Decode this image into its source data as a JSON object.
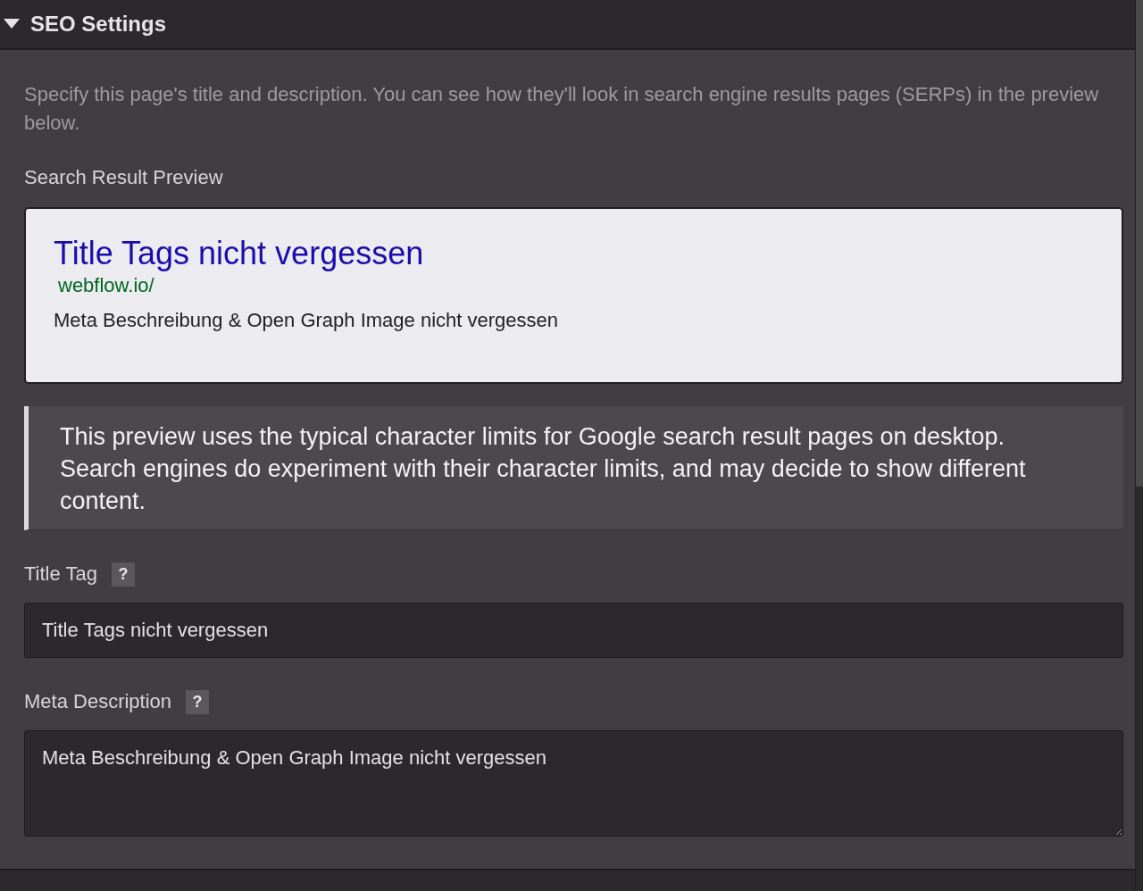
{
  "section": {
    "title": "SEO Settings",
    "expanded": true
  },
  "description": "Specify this page's title and description. You can see how they'll look in search engine results pages (SERPs) in the preview below.",
  "preview_label": "Search Result Preview",
  "preview": {
    "title": "Title Tags nicht vergessen",
    "url": "webflow.io/",
    "description": "Meta Beschreibung & Open Graph Image nicht vergessen"
  },
  "notice": "This preview uses the typical character limits for Google search result pages on desktop. Search engines do experiment with their character limits, and may decide to show different content.",
  "fields": [
    {
      "kind": "input",
      "label": "Title Tag",
      "help": "?",
      "value": "Title Tags nicht vergessen"
    },
    {
      "kind": "textarea",
      "label": "Meta Description",
      "help": "?",
      "value": "Meta Beschreibung & Open Graph Image nicht vergessen"
    }
  ]
}
